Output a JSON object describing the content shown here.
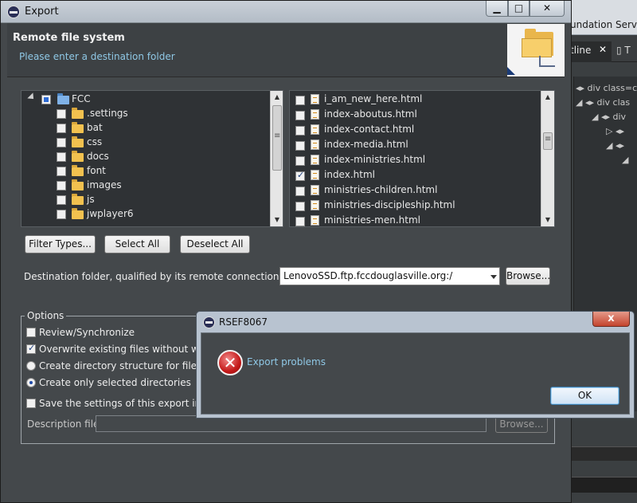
{
  "background_ide": {
    "title_fragment": "undation Server",
    "tab_outline": "tline",
    "tab_other": "T",
    "tree_items": [
      "div class=c",
      "div clas",
      "div",
      "",
      ""
    ]
  },
  "export_dialog": {
    "title": "Export",
    "window_buttons": {
      "minimize": "▁",
      "maximize": "□",
      "close": "✕"
    },
    "header": {
      "title": "Remote file system",
      "subtitle": "Please enter a destination folder"
    },
    "folder_tree": {
      "root": "FCC",
      "children": [
        ".settings",
        "bat",
        "css",
        "docs",
        "font",
        "images",
        "js",
        "jwplayer6"
      ]
    },
    "file_list": [
      {
        "name": "i_am_new_here.html",
        "checked": false
      },
      {
        "name": "index-aboutus.html",
        "checked": false
      },
      {
        "name": "index-contact.html",
        "checked": false
      },
      {
        "name": "index-media.html",
        "checked": false
      },
      {
        "name": "index-ministries.html",
        "checked": false
      },
      {
        "name": "index.html",
        "checked": true
      },
      {
        "name": "ministries-children.html",
        "checked": false
      },
      {
        "name": "ministries-discipleship.html",
        "checked": false
      },
      {
        "name": "ministries-men.html",
        "checked": false
      }
    ],
    "buttons": {
      "filter_types": "Filter Types...",
      "select_all": "Select All",
      "deselect_all": "Deselect All",
      "browse": "Browse..."
    },
    "destination": {
      "label": "Destination folder, qualified by its remote connection name:",
      "value": "LenovoSSD.ftp.fccdouglasville.org:/"
    },
    "options": {
      "legend": "Options",
      "review_sync": {
        "label": "Review/Synchronize",
        "checked": false
      },
      "overwrite": {
        "label": "Overwrite existing files without warni",
        "checked": true
      },
      "create_dir_structure": {
        "label": "Create directory structure for files",
        "selected": false
      },
      "create_selected_dirs": {
        "label": "Create only selected directories",
        "selected": true
      },
      "save_settings": {
        "label": "Save the settings of this export in the",
        "checked": false
      },
      "description_label": "Description file:",
      "description_value": "",
      "description_browse": "Browse..."
    }
  },
  "error_dialog": {
    "title": "RSEF8067",
    "message": "Export problems",
    "ok_label": "OK",
    "close_label": "x",
    "icon_glyph": "✕"
  }
}
